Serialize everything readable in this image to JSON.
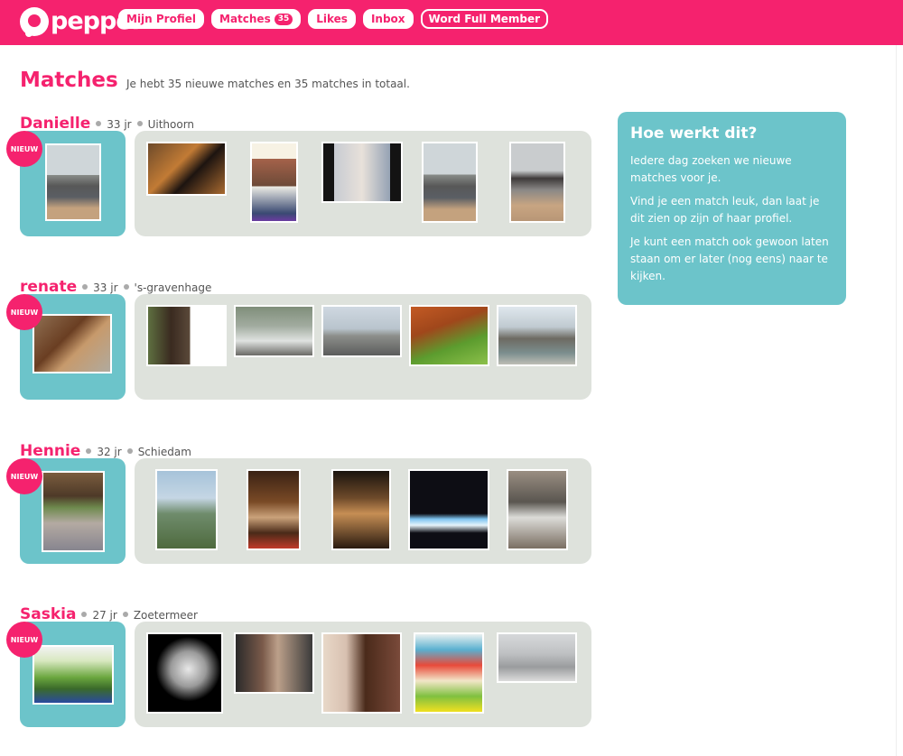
{
  "app": {
    "logo_text": "pepper"
  },
  "nav": {
    "items": [
      {
        "label": "Mijn Profiel",
        "badge": ""
      },
      {
        "label": "Matches",
        "badge": "35"
      },
      {
        "label": "Likes",
        "badge": ""
      },
      {
        "label": "Inbox",
        "badge": ""
      },
      {
        "label": "Word Full Member",
        "badge": ""
      }
    ]
  },
  "page": {
    "title": "Matches",
    "subtitle": "Je hebt 35 nieuwe matches en 35 matches in totaal."
  },
  "badge_label": "NIEUW",
  "matches": [
    {
      "name": "Danielle",
      "age": "33 jr",
      "city": "Uithoorn"
    },
    {
      "name": "renate",
      "age": "33 jr",
      "city": "'s-gravenhage"
    },
    {
      "name": "Hennie",
      "age": "32 jr",
      "city": "Schiedam"
    },
    {
      "name": "Saskia",
      "age": "27 jr",
      "city": "Zoetermeer"
    }
  ],
  "help": {
    "title": "Hoe werkt dit?",
    "p1": "Iedere dag zoeken we nieuwe matches voor je.",
    "p2": "Vind je een match leuk, dan laat je dit zien op zijn of haar profiel.",
    "p3": "Je kunt een match ook gewoon laten staan om er later (nog eens) naar te kijken."
  },
  "colors": {
    "brand": "#f5226e",
    "teal": "#6cc4ca",
    "gallery_bg": "#dee2dc"
  }
}
